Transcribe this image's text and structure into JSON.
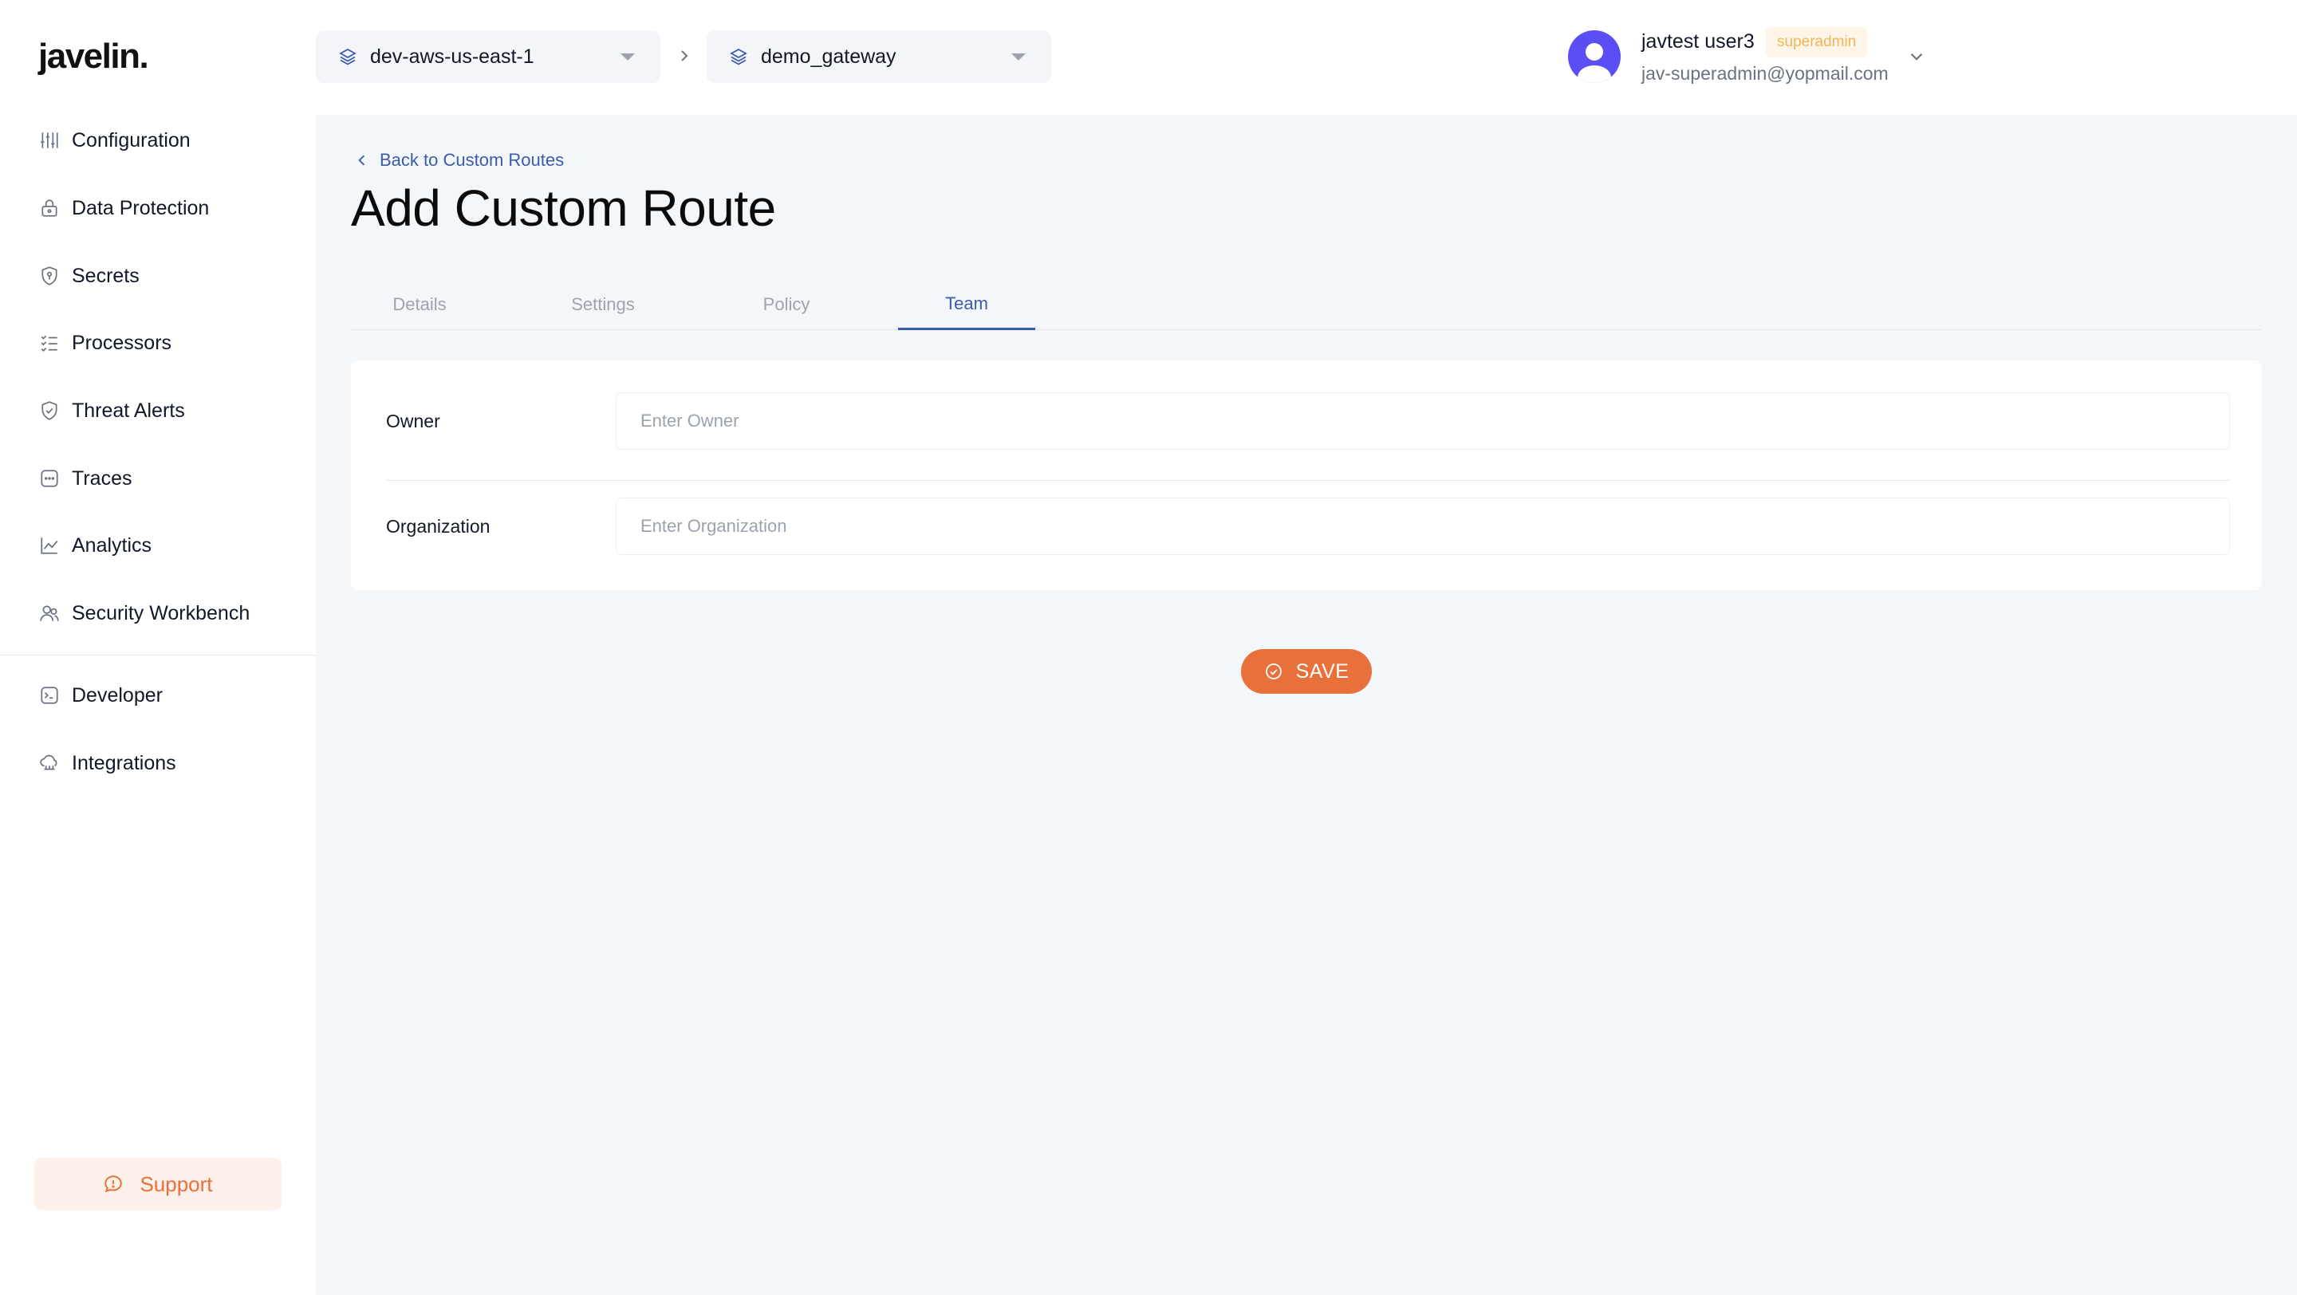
{
  "brand": {
    "logo_text": "javelin."
  },
  "sidebar": {
    "items": [
      {
        "label": "Configuration",
        "icon": "sliders-icon"
      },
      {
        "label": "Data Protection",
        "icon": "lock-icon"
      },
      {
        "label": "Secrets",
        "icon": "shield-key-icon"
      },
      {
        "label": "Processors",
        "icon": "list-check-icon"
      },
      {
        "label": "Threat Alerts",
        "icon": "shield-check-icon"
      },
      {
        "label": "Traces",
        "icon": "trace-box-icon"
      },
      {
        "label": "Analytics",
        "icon": "line-chart-icon"
      },
      {
        "label": "Security Workbench",
        "icon": "users-icon"
      },
      {
        "label": "Developer",
        "icon": "terminal-icon"
      },
      {
        "label": "Integrations",
        "icon": "cloud-link-icon"
      }
    ],
    "support_label": "Support"
  },
  "header": {
    "environment": "dev-aws-us-east-1",
    "gateway": "demo_gateway",
    "user": {
      "name": "javtest user3",
      "role": "superadmin",
      "email": "jav-superadmin@yopmail.com"
    }
  },
  "main": {
    "back_label": "Back to Custom Routes",
    "title": "Add Custom Route",
    "tabs": [
      {
        "label": "Details",
        "active": false
      },
      {
        "label": "Settings",
        "active": false
      },
      {
        "label": "Policy",
        "active": false
      },
      {
        "label": "Team",
        "active": true
      }
    ],
    "form": {
      "owner": {
        "label": "Owner",
        "placeholder": "Enter Owner",
        "value": ""
      },
      "organization": {
        "label": "Organization",
        "placeholder": "Enter Organization",
        "value": ""
      }
    },
    "save_label": "SAVE"
  },
  "colors": {
    "accent": "#e8703a",
    "primary_blue": "#3b5bab",
    "avatar": "#5b4ef5",
    "badge_text": "#f2b45a"
  }
}
